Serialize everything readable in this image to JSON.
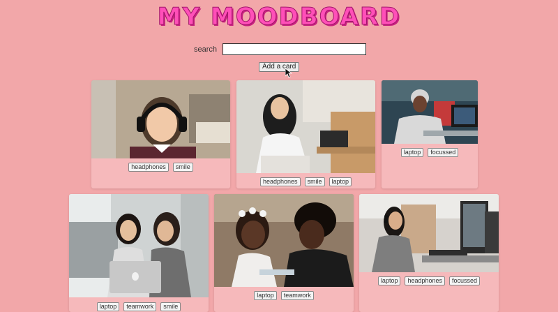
{
  "header": {
    "title": "MY MOODBOARD"
  },
  "search": {
    "label": "search",
    "value": "",
    "placeholder": ""
  },
  "toolbar": {
    "add_card_label": "Add a card"
  },
  "cards": [
    {
      "tags": [
        "headphones",
        "smile"
      ]
    },
    {
      "tags": [
        "headphones",
        "smile",
        "laptop"
      ]
    },
    {
      "tags": [
        "laptop",
        "focussed"
      ]
    },
    {
      "tags": [
        "laptop",
        "teamwork",
        "smile"
      ]
    },
    {
      "tags": [
        "laptop",
        "teamwork"
      ]
    },
    {
      "tags": [
        "laptop",
        "headphones",
        "focussed"
      ]
    }
  ],
  "colors": {
    "background": "#f2a7a9",
    "card": "#f6b9bb",
    "title": "#ff4fb8"
  }
}
